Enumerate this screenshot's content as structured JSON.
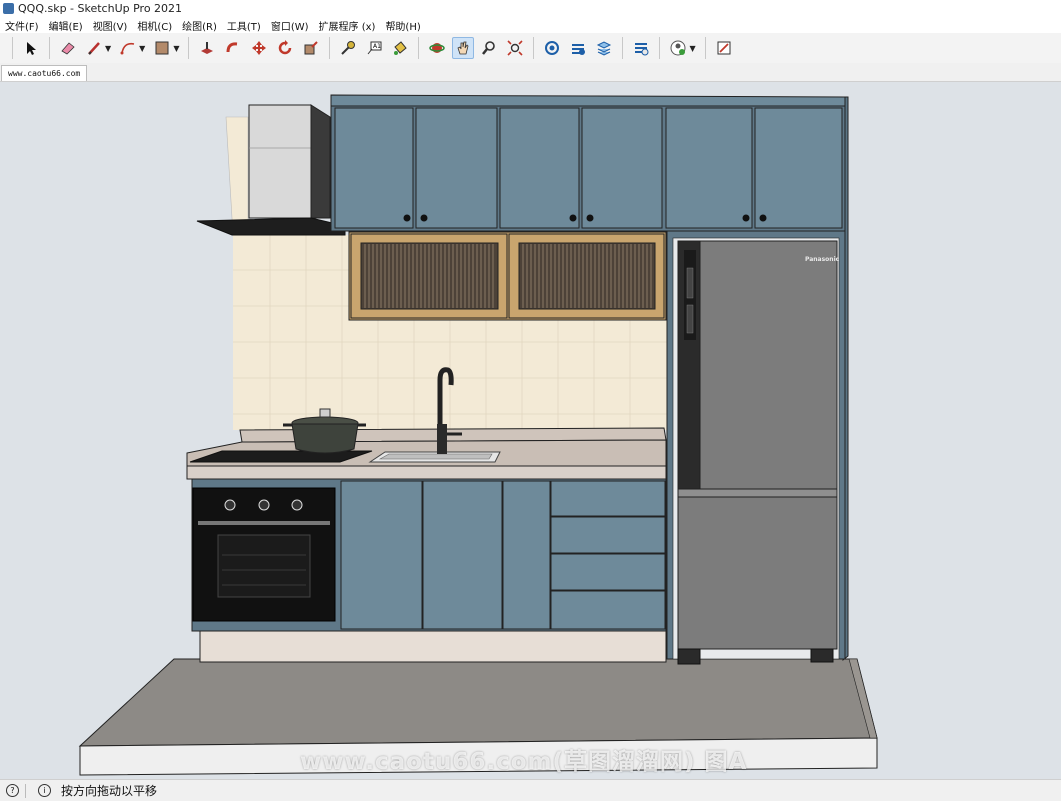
{
  "window": {
    "title": "QQQ.skp - SketchUp Pro 2021"
  },
  "menu": [
    "文件(F)",
    "编辑(E)",
    "视图(V)",
    "相机(C)",
    "绘图(R)",
    "工具(T)",
    "窗口(W)",
    "扩展程序 (x)",
    "帮助(H)"
  ],
  "toolbar": {
    "tools": [
      "select-tool",
      "eraser-tool",
      "line-tool",
      "arc-tool",
      "shape-tool",
      "push-pull-tool",
      "follow-me-tool",
      "move-tool",
      "rotate-tool",
      "scale-tool",
      "tape-measure-tool",
      "text-tool",
      "paint-bucket-tool",
      "orbit-tool",
      "pan-tool",
      "zoom-tool",
      "zoom-extents-tool",
      "warehouse-tool",
      "extension-warehouse-tool",
      "layout-tool",
      "extension-manager-tool",
      "account-tool",
      "send-to-layout-tool"
    ],
    "active_tool": "pan-tool"
  },
  "tabs": [
    {
      "label": "www.caotu66.com"
    }
  ],
  "viewport": {
    "watermark": "www.caotu66.com(草图溜溜网) 图A",
    "fridge_brand": "Panasonic",
    "colors": {
      "cabinet": "#6e8a9a",
      "background": "#dde2e7",
      "floor": "#8d8a86",
      "tile": "#f3ead6",
      "wood": "#c9a56e",
      "fridge": "#7c7c7c"
    }
  },
  "status": {
    "message": "按方向拖动以平移"
  }
}
